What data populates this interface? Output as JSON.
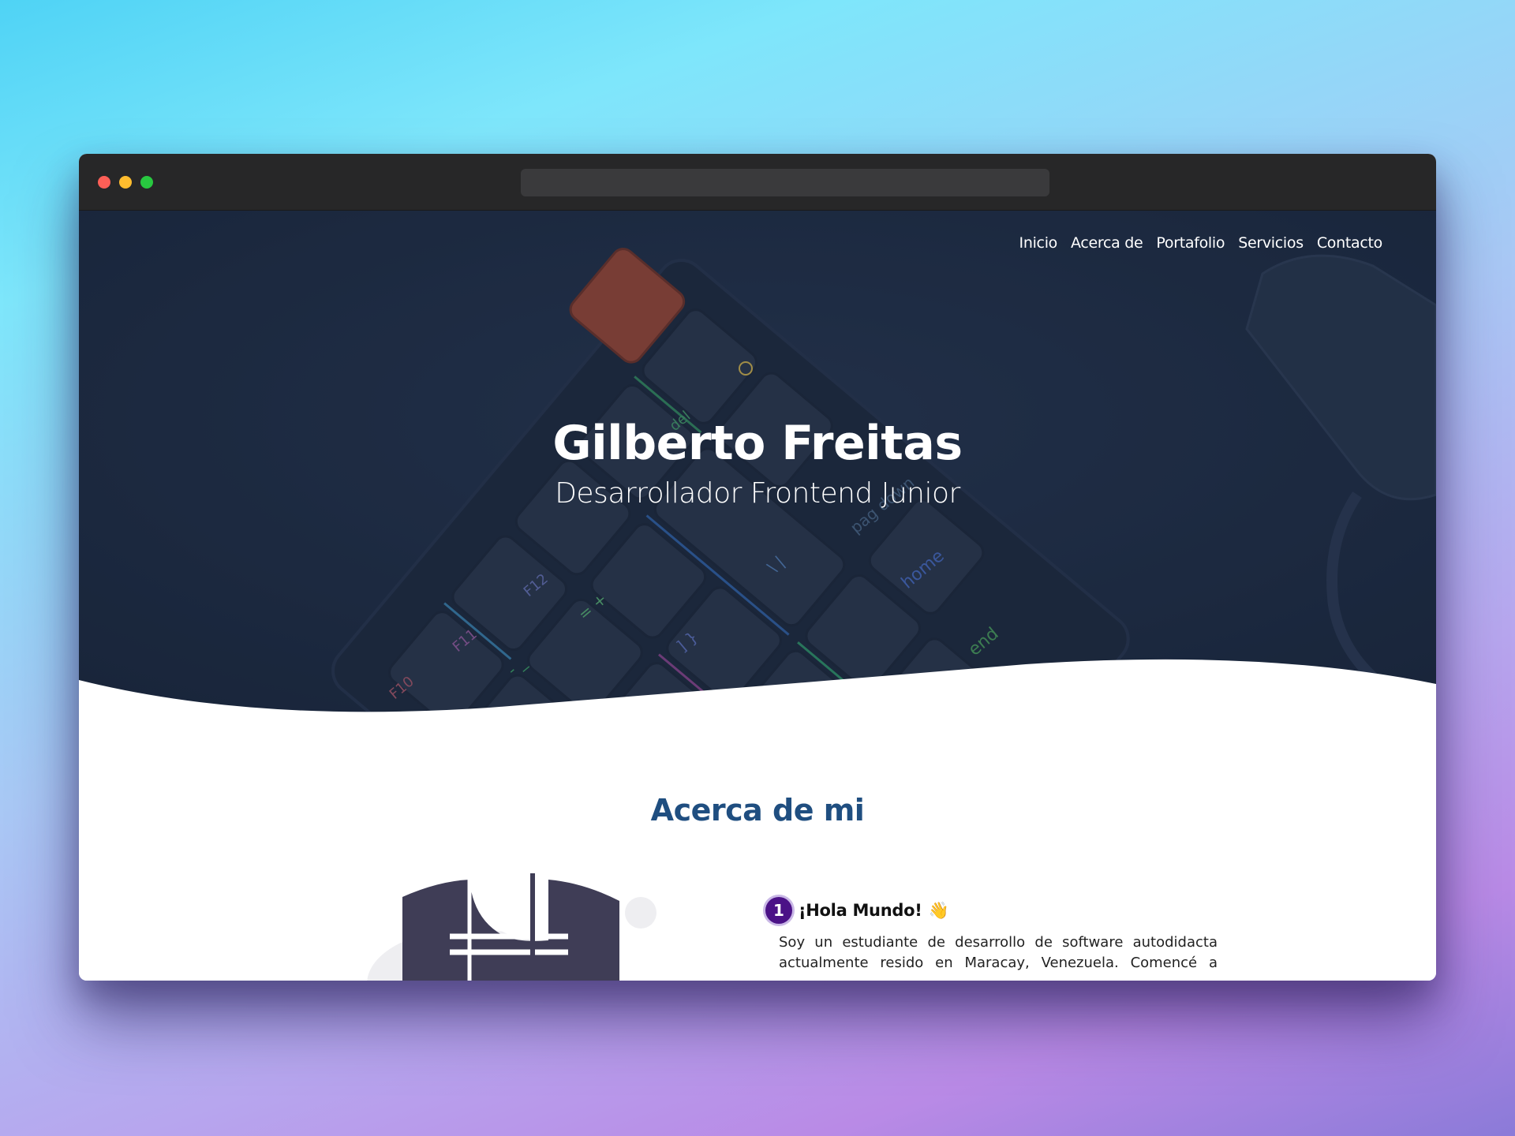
{
  "nav": {
    "items": [
      {
        "label": "Inicio"
      },
      {
        "label": "Acerca de"
      },
      {
        "label": "Portafolio"
      },
      {
        "label": "Servicios"
      },
      {
        "label": "Contacto"
      }
    ]
  },
  "hero": {
    "title": "Gilberto Freitas",
    "subtitle": "Desarrollador Frontend Junior"
  },
  "keyboard_labels": {
    "f10": "F10",
    "f11": "F11",
    "f12": "F12",
    "home": "home",
    "end": "end",
    "pgdown": "pag down",
    "del": "del",
    "minus": "- _",
    "equal": "= +",
    "bracket": "] }",
    "backslash": "\\ |"
  },
  "about": {
    "title": "Acerca de mi",
    "step_number": "1",
    "step_title": "¡Hola Mundo!",
    "step_emoji": "👋",
    "text": "Soy un estudiante de desarrollo de software autodidacta actualmente resido en Maracay, Venezuela. Comencé a"
  },
  "colors": {
    "hero_overlay": "#1d2a42",
    "accent_title": "#1f4e80",
    "badge": "#4b1287",
    "window_titlebar": "#272728",
    "traffic_red": "#fe5f57",
    "traffic_yellow": "#febc2e",
    "traffic_green": "#28c840"
  }
}
